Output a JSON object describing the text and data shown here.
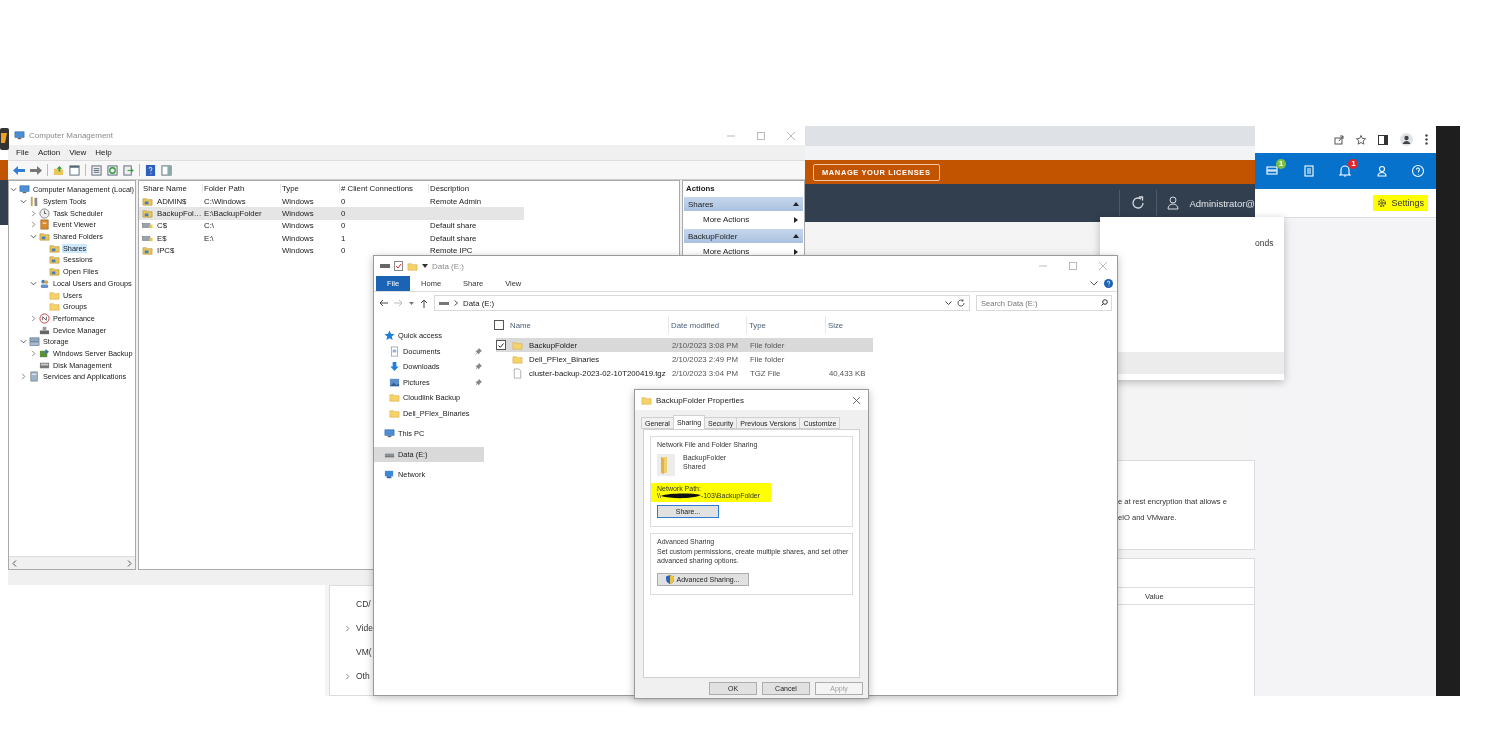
{
  "vsphere": {
    "license_button": "MANAGE YOUR LICENSES",
    "user": "Administrator@",
    "side_items": [
      {
        "label": "CD/"
      },
      {
        "label": "Vide",
        "expanded": false
      },
      {
        "label": "VM("
      },
      {
        "label": "Oth",
        "expanded": false
      }
    ],
    "panel_texts": [
      "e at rest encryption that allows e",
      "elO and VMware."
    ],
    "table_header": "Value"
  },
  "popup": {
    "text": "onds"
  },
  "browser": {
    "icons": [
      {
        "kind": "storage",
        "badge": "1",
        "color": "#7cc242"
      },
      {
        "kind": "calendar"
      },
      {
        "kind": "bell",
        "badge": "1",
        "color": "#e0252b"
      },
      {
        "kind": "user"
      },
      {
        "kind": "help"
      }
    ],
    "settings": {
      "label": "Settings",
      "highlighted": true
    }
  },
  "computer_management": {
    "title": "Computer Management",
    "menu": [
      "File",
      "Action",
      "View",
      "Help"
    ],
    "tree": [
      {
        "label": "Computer Management (Local)",
        "kind": "computer",
        "selected": false,
        "expanded": true,
        "children": [
          {
            "label": "System Tools",
            "kind": "tools",
            "selected": false,
            "expanded": true,
            "children": [
              {
                "label": "Task Scheduler",
                "kind": "clock",
                "selected": false,
                "expanded": false
              },
              {
                "label": "Event Viewer",
                "kind": "event",
                "selected": false,
                "expanded": false
              },
              {
                "label": "Shared Folders",
                "kind": "share",
                "selected": false,
                "expanded": true,
                "children": [
                  {
                    "label": "Shares",
                    "kind": "share",
                    "selected": true
                  },
                  {
                    "label": "Sessions",
                    "kind": "share",
                    "selected": false
                  },
                  {
                    "label": "Open Files",
                    "kind": "share",
                    "selected": false
                  }
                ]
              },
              {
                "label": "Local Users and Groups",
                "kind": "users",
                "selected": false,
                "expanded": true,
                "children": [
                  {
                    "label": "Users",
                    "kind": "folder",
                    "selected": false
                  },
                  {
                    "label": "Groups",
                    "kind": "folder",
                    "selected": false
                  }
                ]
              },
              {
                "label": "Performance",
                "kind": "perf",
                "selected": false,
                "expanded": false
              },
              {
                "label": "Device Manager",
                "kind": "device",
                "selected": false
              }
            ]
          },
          {
            "label": "Storage",
            "kind": "storage",
            "selected": false,
            "expanded": true,
            "children": [
              {
                "label": "Windows Server Backup",
                "kind": "backup",
                "selected": false,
                "expanded": false
              },
              {
                "label": "Disk Management",
                "kind": "disk",
                "selected": false
              }
            ]
          },
          {
            "label": "Services and Applications",
            "kind": "services",
            "selected": false,
            "expanded": false
          }
        ]
      }
    ],
    "columns": [
      "Share Name",
      "Folder Path",
      "Type",
      "# Client Connections",
      "Description"
    ],
    "rows": [
      {
        "share_name": "ADMIN$",
        "folder_path": "C:\\Windows",
        "type": "Windows",
        "client_connections": "0",
        "description": "Remote Admin",
        "kind": "share",
        "selected": false
      },
      {
        "share_name": "BackupFol…",
        "folder_path": "E:\\BackupFolder",
        "type": "Windows",
        "client_connections": "0",
        "kind": "share",
        "selected": true
      },
      {
        "share_name": "C$",
        "folder_path": "C:\\",
        "type": "Windows",
        "client_connections": "0",
        "description": "Default share",
        "kind": "drive_share",
        "selected": false
      },
      {
        "share_name": "E$",
        "folder_path": "E:\\",
        "type": "Windows",
        "client_connections": "1",
        "description": "Default share",
        "kind": "drive_share",
        "selected": false
      },
      {
        "share_name": "IPC$",
        "type": "Windows",
        "client_connections": "0",
        "description": "Remote IPC",
        "kind": "share",
        "selected": false
      }
    ],
    "actions": {
      "title": "Actions",
      "sections": [
        {
          "label": "Shares",
          "expanded": true,
          "items": [
            "More Actions"
          ]
        },
        {
          "label": "BackupFolder",
          "expanded": true,
          "items": [
            "More Actions"
          ]
        }
      ]
    }
  },
  "explorer": {
    "title": "Data (E:)",
    "ribbon_tabs": [
      {
        "label": "File",
        "selected": true
      },
      {
        "label": "Home",
        "selected": false
      },
      {
        "label": "Share",
        "selected": false
      },
      {
        "label": "View",
        "selected": false
      }
    ],
    "address": "Data (E:)",
    "search": {
      "placeholder": "Search Data (E:)"
    },
    "nav": [
      {
        "label": "Quick access",
        "kind": "star",
        "selected": false,
        "pinned": false,
        "children": [
          {
            "label": "Documents",
            "kind": "document",
            "selected": false,
            "pinned": true
          },
          {
            "label": "Downloads",
            "kind": "download",
            "selected": false,
            "pinned": true
          },
          {
            "label": "Pictures",
            "kind": "pictures",
            "selected": false,
            "pinned": true
          },
          {
            "label": "Cloudlink Backup",
            "kind": "folder",
            "selected": false,
            "pinned": false
          },
          {
            "label": "Dell_PFlex_Binaries",
            "kind": "folder",
            "selected": false,
            "pinned": false
          }
        ]
      },
      {
        "label": "This PC",
        "kind": "pc",
        "selected": false,
        "pinned": false
      },
      {
        "label": "Data (E:)",
        "kind": "drive",
        "selected": true,
        "pinned": false
      },
      {
        "label": "Network",
        "kind": "network",
        "selected": false,
        "pinned": false
      }
    ],
    "select_all": {
      "checked": false
    },
    "columns": [
      "Name",
      "Date modified",
      "Type",
      "Size"
    ],
    "files": [
      {
        "name": "BackupFolder",
        "modified": "2/10/2023 3:08 PM",
        "type": "File folder",
        "kind": "folder",
        "selected": true,
        "checked": true
      },
      {
        "name": "Dell_PFlex_Binaries",
        "modified": "2/10/2023 2:49 PM",
        "type": "File folder",
        "kind": "folder",
        "selected": false,
        "checked": false
      },
      {
        "name": "cluster-backup-2023-02-10T200419.tgz",
        "modified": "2/10/2023 3:04 PM",
        "type": "TGZ File",
        "size": "40,433 KB",
        "kind": "file",
        "selected": false,
        "checked": false
      }
    ]
  },
  "properties": {
    "title": "BackupFolder Properties",
    "tabs": [
      {
        "label": "General",
        "selected": false
      },
      {
        "label": "Sharing",
        "selected": true
      },
      {
        "label": "Security",
        "selected": false
      },
      {
        "label": "Previous Versions",
        "selected": false
      },
      {
        "label": "Customize",
        "selected": false
      }
    ],
    "sharing_group": {
      "title": "Network File and Folder Sharing",
      "folder_name": "BackupFolder",
      "status": "Shared",
      "path_label": "Network Path:",
      "path_start": "\\\\",
      "path_end": "-103\\BackupFolder",
      "highlighted": true,
      "button": "Share..."
    },
    "advanced_group": {
      "title": "Advanced Sharing",
      "text": "Set custom permissions, create multiple shares, and set other advanced sharing options.",
      "button": "Advanced Sharing..."
    },
    "buttons": [
      {
        "label": "OK",
        "disabled": false
      },
      {
        "label": "Cancel",
        "disabled": false
      },
      {
        "label": "Apply",
        "disabled": true
      }
    ]
  }
}
